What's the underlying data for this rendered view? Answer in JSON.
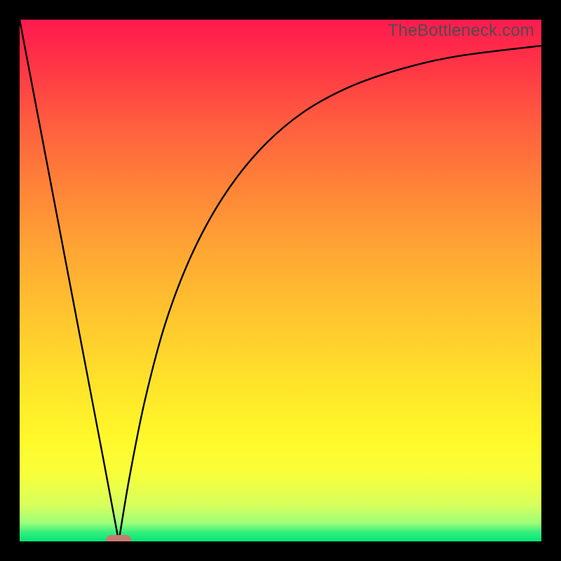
{
  "watermark": "TheBottleneck.com",
  "colors": {
    "frame": "#000000",
    "gradient_top": "#ff1a4f",
    "gradient_mid": "#ffe42a",
    "gradient_bottom": "#00e676",
    "curve": "#000000",
    "marker": "#c77b71",
    "watermark": "#4d4d4d"
  },
  "chart_data": {
    "type": "line",
    "title": "",
    "xlabel": "",
    "ylabel": "",
    "xlim": [
      0,
      100
    ],
    "ylim": [
      0,
      100
    ],
    "annotations": [
      "TheBottleneck.com"
    ],
    "optimum_x": 19,
    "marker": {
      "x": 19,
      "y": 0,
      "shape": "pill",
      "color": "#c77b71"
    },
    "series": [
      {
        "name": "left-branch",
        "x": [
          0,
          4,
          8,
          12,
          16,
          19
        ],
        "values": [
          100,
          79,
          58,
          37,
          16,
          0
        ]
      },
      {
        "name": "right-branch",
        "x": [
          19,
          21,
          24,
          28,
          33,
          39,
          46,
          54,
          63,
          73,
          84,
          100
        ],
        "values": [
          0,
          12,
          27,
          42,
          55,
          66,
          75,
          82,
          87,
          90.5,
          93,
          95
        ]
      }
    ]
  }
}
